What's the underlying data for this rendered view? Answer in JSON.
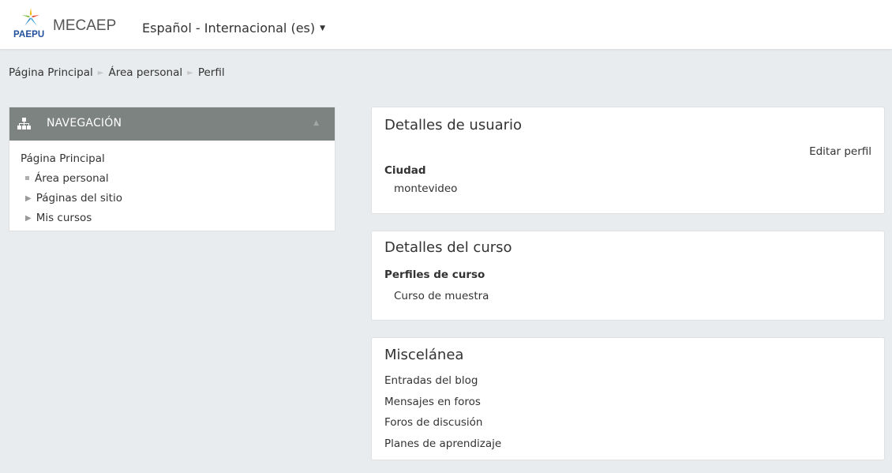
{
  "header": {
    "logo_text": "PAEPU",
    "site_name": "MECAEP",
    "language": "Español - Internacional (es)"
  },
  "breadcrumb": [
    "Página Principal",
    "Área personal",
    "Perfil"
  ],
  "navigation": {
    "title": "NAVEGACIÓN",
    "home": "Página Principal",
    "items": [
      "Área personal",
      "Páginas del sitio",
      "Mis cursos"
    ]
  },
  "user_details": {
    "title": "Detalles de usuario",
    "edit_label": "Editar perfil",
    "city_label": "Ciudad",
    "city_value": "montevideo"
  },
  "course_details": {
    "title": "Detalles del curso",
    "profiles_label": "Perfiles de curso",
    "course": "Curso de muestra"
  },
  "misc": {
    "title": "Miscelánea",
    "links": [
      "Entradas del blog",
      "Mensajes en foros",
      "Foros de discusión",
      "Planes de aprendizaje"
    ]
  },
  "colors": {
    "nav_header_bg": "#7d8381",
    "page_bg": "#e9ecee",
    "logo_blue": "#1f4e9a"
  }
}
